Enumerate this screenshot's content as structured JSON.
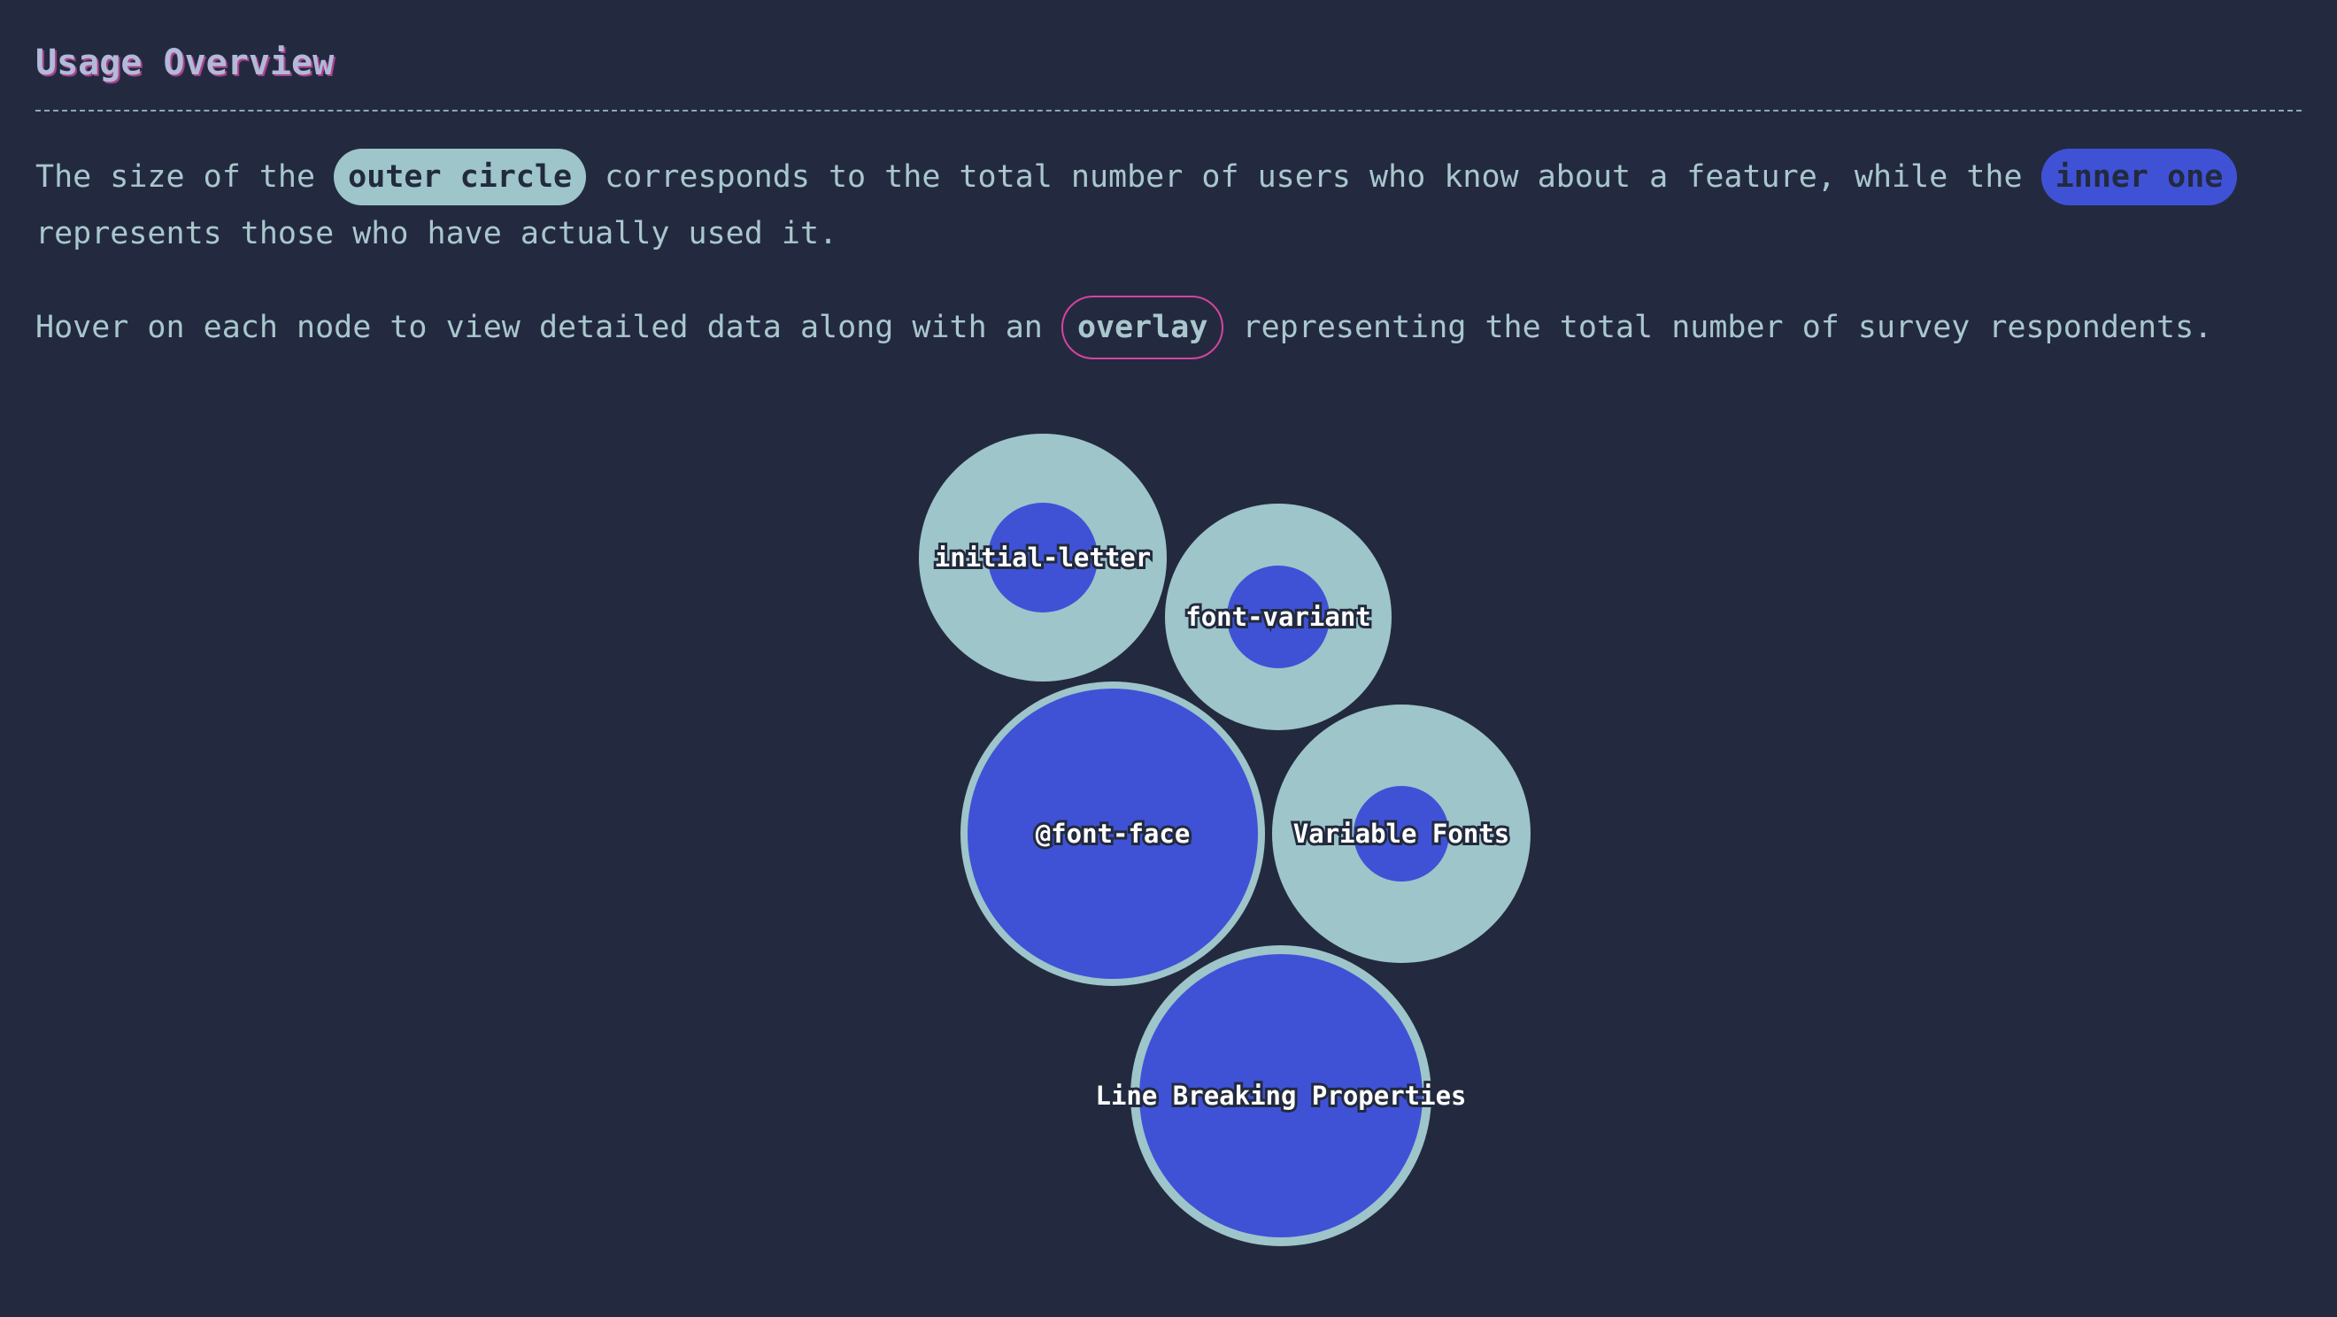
{
  "header": {
    "title": "Usage Overview"
  },
  "intro": {
    "p1_before": "The size of the ",
    "outer_pill": "outer circle",
    "p1_middle": " corresponds to the total number of users who know about a feature, while the ",
    "inner_pill": "inner one",
    "p1_after": " represents those who have actually used it.",
    "p2_before": "Hover on each node to view detailed data along with an ",
    "overlay_pill": "overlay",
    "p2_after": " representing the total number of survey respondents."
  },
  "colors": {
    "background": "#232a40",
    "outer_circle": "#9ec5c9",
    "inner_circle": "#3f52d6",
    "overlay_accent": "#d6449c",
    "text": "#a9c7cd"
  },
  "chart_data": {
    "type": "bubble",
    "title": "",
    "encoding": {
      "outer_radius": "users who know about the feature (relative)",
      "inner_radius": "users who have used the feature (relative)"
    },
    "features": [
      {
        "name": "initial-letter",
        "known": 0.7,
        "used": 0.31
      },
      {
        "name": "font-variant",
        "known": 0.64,
        "used": 0.29
      },
      {
        "name": "@font-face",
        "known": 0.86,
        "used": 0.82
      },
      {
        "name": "Variable Fonts",
        "known": 0.73,
        "used": 0.27
      },
      {
        "name": "Line Breaking Properties",
        "known": 0.85,
        "used": 0.8
      }
    ]
  }
}
